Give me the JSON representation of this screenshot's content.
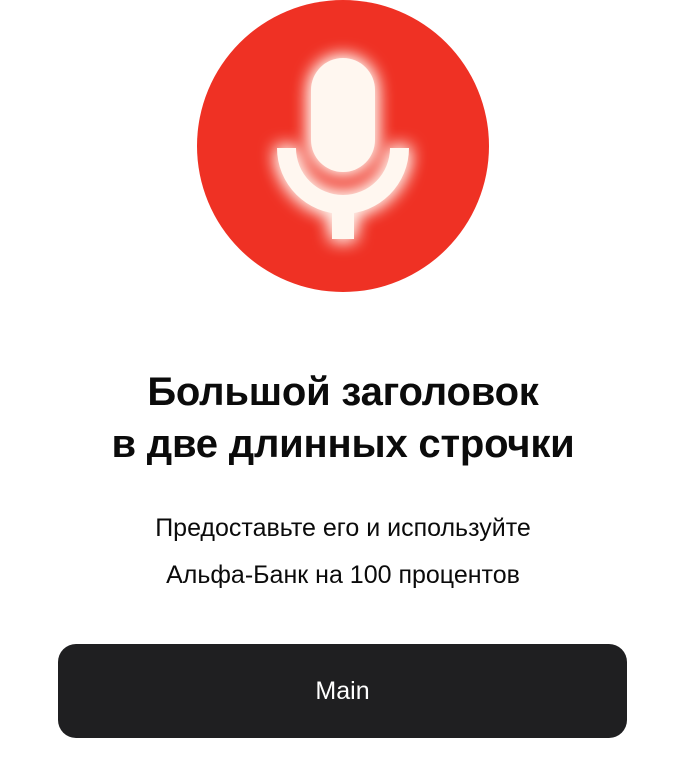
{
  "hero": {
    "icon": "microphone-icon",
    "circle_color": "#ef3124",
    "glyph_color": "#ffffff"
  },
  "title": {
    "line1": "Большой заголовок",
    "line2": "в две длинных строчки"
  },
  "subtitle": {
    "line1": "Предоставьте его и используйте",
    "line2": "Альфа-Банк на 100 процентов"
  },
  "button": {
    "label": "Main",
    "background": "#1f1f21",
    "text_color": "#ffffff"
  }
}
